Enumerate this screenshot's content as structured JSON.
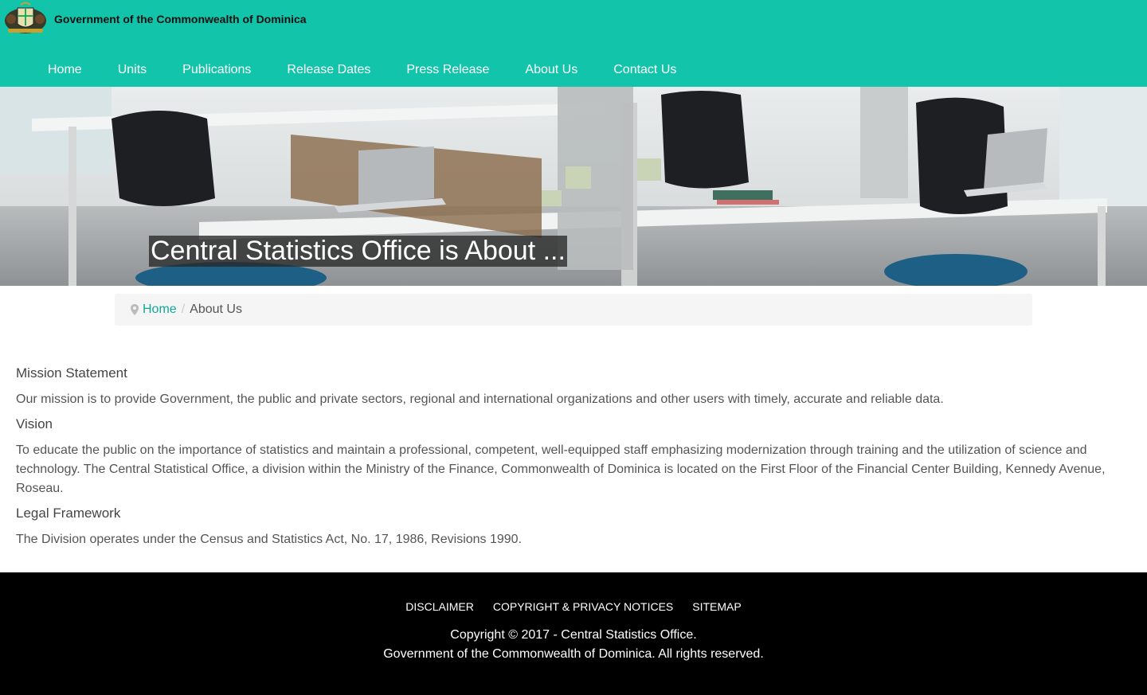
{
  "header": {
    "crest_icon": "dominica-coat-of-arms-icon",
    "title": "Government of the Commonwealth of Dominica",
    "background": "#12c4a9"
  },
  "nav": {
    "items": [
      {
        "label": "Home"
      },
      {
        "label": "Units"
      },
      {
        "label": "Publications"
      },
      {
        "label": "Release Dates"
      },
      {
        "label": "Press Release"
      },
      {
        "label": "About Us"
      },
      {
        "label": "Contact Us"
      }
    ]
  },
  "hero": {
    "caption": "Central Statistics Office is About ..."
  },
  "breadcrumb": {
    "icon": "map-marker-icon",
    "home": "Home",
    "separator": "/",
    "current": "About Us"
  },
  "content": {
    "mission_heading": "Mission Statement",
    "mission_text": "Our mission is to provide Government, the public and private sectors, regional and international organizations and other users with timely, accurate and reliable data.",
    "vision_heading": "Vision",
    "vision_text": "To educate the public on the importance of statistics and maintain a professional, competent, well-equipped staff emphasizing modernization through training and the utilization of science and technology. The Central Statistical Office, a division within the Ministry of the Finance, Commonwealth of Dominica is located on the First Floor of the Financial Center Building, Kennedy Avenue, Roseau.",
    "legal_heading": "Legal Framework",
    "legal_text": "The Division operates under the Census and Statistics Act, No. 17, 1986, Revisions 1990."
  },
  "footer": {
    "links": [
      {
        "label": "DISCLAIMER"
      },
      {
        "label": "COPYRIGHT & PRIVACY NOTICES"
      },
      {
        "label": "SITEMAP"
      }
    ],
    "copyright_line1": "Copyright © 2017 - Central Statistics Office.",
    "copyright_line2": "Government of the Commonwealth of Dominica. All rights reserved."
  }
}
